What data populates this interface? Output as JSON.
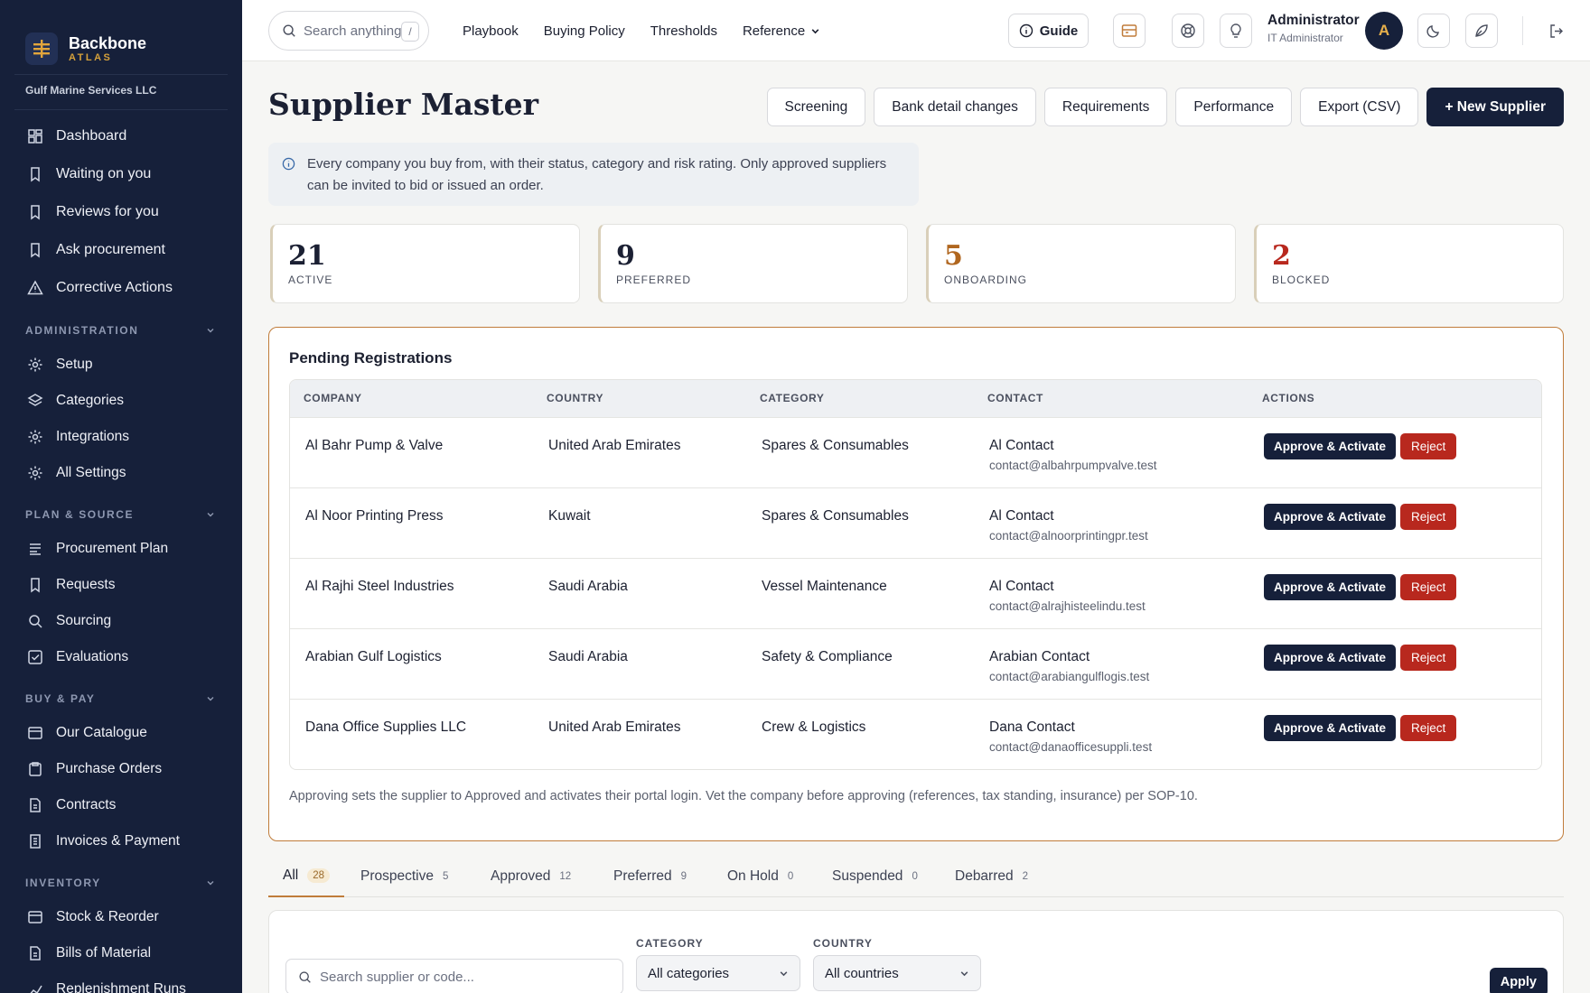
{
  "brand": {
    "title": "Backbone",
    "subtitle": "ATLAS",
    "org": "Gulf Marine Services LLC"
  },
  "sidebar": {
    "top_items": [
      {
        "label": "Dashboard",
        "icon": "dashboard-icon"
      },
      {
        "label": "Waiting on you",
        "icon": "bookmark-icon"
      },
      {
        "label": "Reviews for you",
        "icon": "bookmark-icon"
      },
      {
        "label": "Ask procurement",
        "icon": "bookmark-icon"
      },
      {
        "label": "Corrective Actions",
        "icon": "warning-icon"
      }
    ],
    "sections": [
      {
        "title": "ADMINISTRATION",
        "items": [
          "Setup",
          "Categories",
          "Integrations",
          "All Settings"
        ]
      },
      {
        "title": "PLAN & SOURCE",
        "items": [
          "Procurement Plan",
          "Requests",
          "Sourcing",
          "Evaluations"
        ]
      },
      {
        "title": "BUY & PAY",
        "items": [
          "Our Catalogue",
          "Purchase Orders",
          "Contracts",
          "Invoices & Payment"
        ]
      },
      {
        "title": "INVENTORY",
        "items": [
          "Stock & Reorder",
          "Bills of Material",
          "Replenishment Runs"
        ]
      }
    ]
  },
  "topbar": {
    "search_placeholder": "Search anything",
    "search_shortcut": "/",
    "links": [
      "Playbook",
      "Buying Policy",
      "Thresholds",
      "Reference"
    ],
    "guide_label": "Guide",
    "user_name": "Administrator",
    "user_role": "IT Administrator",
    "avatar_initial": "A"
  },
  "page": {
    "title": "Supplier Master",
    "actions": [
      "Screening",
      "Bank detail changes",
      "Requirements",
      "Performance",
      "Export (CSV)"
    ],
    "primary_action": "+ New Supplier",
    "info": "Every company you buy from, with their status, category and risk rating. Only approved suppliers can be invited to bid or issued an order."
  },
  "stats": [
    {
      "value": "21",
      "label": "ACTIVE",
      "color": "#1b2033"
    },
    {
      "value": "9",
      "label": "PREFERRED",
      "color": "#1b2033"
    },
    {
      "value": "5",
      "label": "ONBOARDING",
      "color": "#b0661f"
    },
    {
      "value": "2",
      "label": "BLOCKED",
      "color": "#b8281e"
    }
  ],
  "pending": {
    "title": "Pending Registrations",
    "columns": [
      "COMPANY",
      "COUNTRY",
      "CATEGORY",
      "CONTACT",
      "ACTIONS"
    ],
    "approve_label": "Approve & Activate",
    "reject_label": "Reject",
    "rows": [
      {
        "company": "Al Bahr Pump & Valve",
        "country": "United Arab Emirates",
        "category": "Spares & Consumables",
        "contact": "Al Contact",
        "email": "contact@albahrpumpvalve.test"
      },
      {
        "company": "Al Noor Printing Press",
        "country": "Kuwait",
        "category": "Spares & Consumables",
        "contact": "Al Contact",
        "email": "contact@alnoorprintingpr.test"
      },
      {
        "company": "Al Rajhi Steel Industries",
        "country": "Saudi Arabia",
        "category": "Vessel Maintenance",
        "contact": "Al Contact",
        "email": "contact@alrajhisteelindu.test"
      },
      {
        "company": "Arabian Gulf Logistics",
        "country": "Saudi Arabia",
        "category": "Safety & Compliance",
        "contact": "Arabian Contact",
        "email": "contact@arabiangulflogis.test"
      },
      {
        "company": "Dana Office Supplies LLC",
        "country": "United Arab Emirates",
        "category": "Crew & Logistics",
        "contact": "Dana Contact",
        "email": "contact@danaofficesuppli.test"
      }
    ],
    "note": "Approving sets the supplier to Approved and activates their portal login. Vet the company before approving (references, tax standing, insurance) per SOP-10."
  },
  "tabs": [
    {
      "label": "All",
      "count": "28"
    },
    {
      "label": "Prospective",
      "count": "5"
    },
    {
      "label": "Approved",
      "count": "12"
    },
    {
      "label": "Preferred",
      "count": "9"
    },
    {
      "label": "On Hold",
      "count": "0"
    },
    {
      "label": "Suspended",
      "count": "0"
    },
    {
      "label": "Debarred",
      "count": "2"
    }
  ],
  "filters": {
    "search_placeholder": "Search supplier or code...",
    "category_label": "CATEGORY",
    "category_value": "All categories",
    "country_label": "COUNTRY",
    "country_value": "All countries",
    "apply_label": "Apply"
  }
}
